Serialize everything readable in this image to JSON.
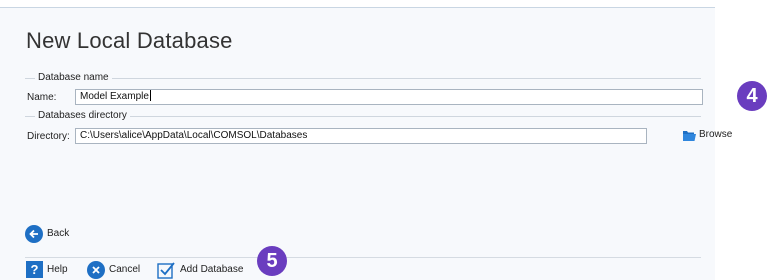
{
  "title": "New Local Database",
  "sections": {
    "name": "Database name",
    "dir": "Databases directory"
  },
  "fields": {
    "name_label": "Name:",
    "name_value": "Model Example",
    "dir_label": "Directory:",
    "dir_value": "C:\\Users\\alice\\AppData\\Local\\COMSOL\\Databases"
  },
  "buttons": {
    "browse": "Browse",
    "back": "Back",
    "help": "Help",
    "cancel": "Cancel",
    "add_database": "Add Database"
  },
  "badges": {
    "step4": "4",
    "step5": "5"
  },
  "colors": {
    "accent": "#1e6fc4",
    "badge": "#6a3dbf"
  },
  "icons": [
    "folder-icon",
    "back-arrow-icon",
    "help-icon",
    "cancel-icon",
    "add-database-icon"
  ]
}
